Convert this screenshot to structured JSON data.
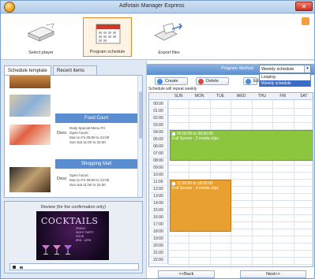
{
  "window": {
    "title": "Adfotain Manager Express"
  },
  "ribbon": {
    "select_player": "Select player",
    "program_schedule": "Program schedule",
    "export_files": "Export files"
  },
  "tabs": [
    "Schedule template",
    "Recent items"
  ],
  "templates": [
    {
      "header": "Food Court",
      "desc_label": "Desc",
      "desc": "Daily Special Menu  Fri\nOpen hours:\nMon to Fri 09:00 to 22:00\nSun Sat 11:00 to 22:00"
    },
    {
      "header": "Shopping Mall",
      "desc_label": "Desc",
      "desc": "Open hours:\nMon to Fri 09:00 to 22:00\nSun Sat 11:00 to 22:00"
    }
  ],
  "review": {
    "title": "Review (for the confirmation only)",
    "poster_title": "COCKTAILS",
    "poster_sub": "FRIDAY\nNIGHT PARTY\nHOUR\n8PM - 10PM"
  },
  "program_method": {
    "label": "Program Method",
    "value": "Weekly schedule",
    "options": [
      "Looping",
      "Weekly schedule"
    ]
  },
  "toolbar": {
    "create": "Create",
    "delete": "Delete",
    "edit": "Ed"
  },
  "schedule": {
    "repeat_label": "Schedule will repeat weekly",
    "days": [
      "SUN",
      "MON",
      "TUE",
      "WED",
      "THU",
      "FRI",
      "SAT"
    ],
    "times": [
      "00:00",
      "01:00",
      "02:00",
      "03:00",
      "04:00",
      "05:00",
      "06:00",
      "07:00",
      "08:00",
      "09:00",
      "10:00",
      "11:00",
      "12:00",
      "13:00",
      "14:00",
      "15:00",
      "16:00",
      "17:00",
      "18:00",
      "19:00",
      "20:00",
      "21:00",
      "22:00"
    ],
    "events": [
      {
        "time": "04:00:00 to 08:00:00",
        "label": "Full Screen - 2 media clips"
      },
      {
        "time": "11:00:00 to 18:00:00",
        "label": "Full Screen - 3 media clips"
      }
    ]
  },
  "nav": {
    "back": "<<Back",
    "next": "Next>>"
  },
  "colors": {
    "accent_blue": "#5a8ed0",
    "green_event": "#8cc63e",
    "orange_event": "#e8a030"
  }
}
